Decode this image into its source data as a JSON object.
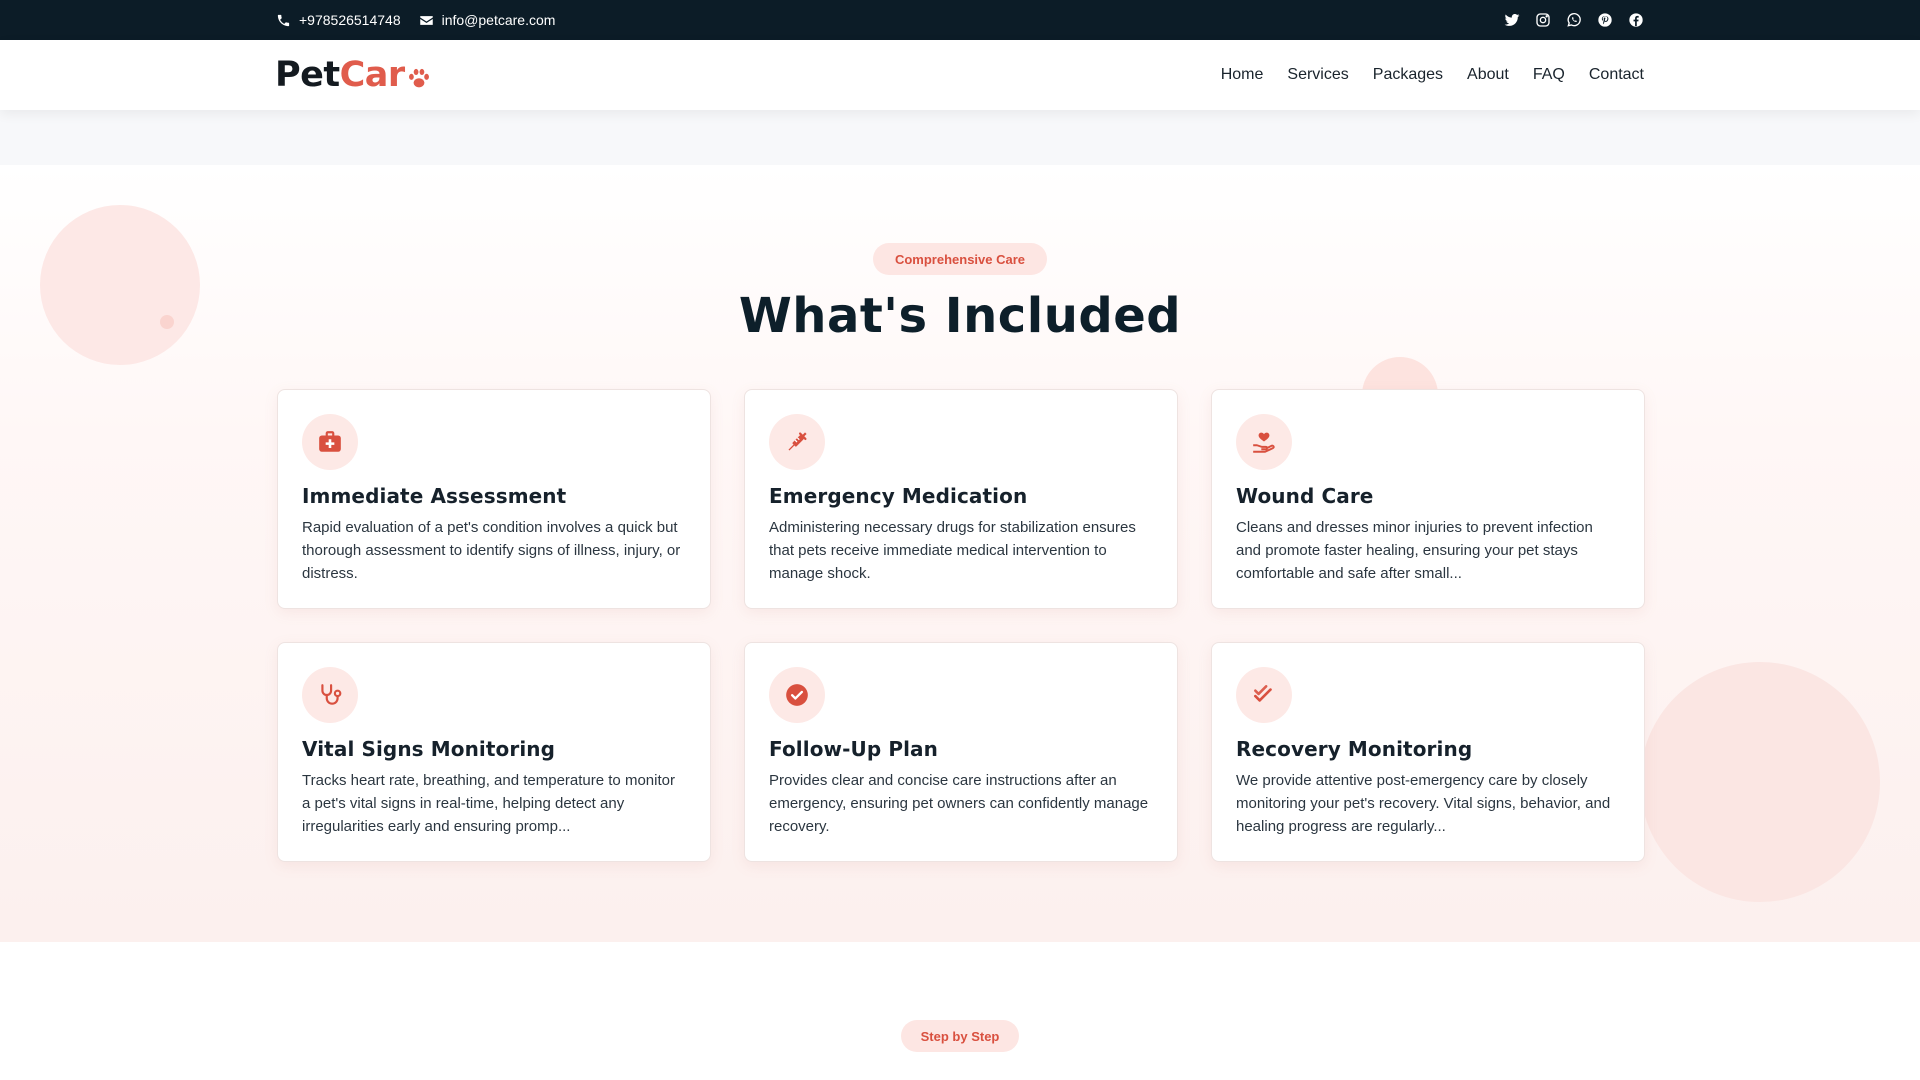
{
  "topbar": {
    "phone": "+978526514748",
    "email": "info@petcare.com",
    "social": [
      "twitter-icon",
      "instagram-icon",
      "whatsapp-icon",
      "pinterest-icon",
      "facebook-icon"
    ]
  },
  "brand": {
    "part1": "Pet",
    "part2": "Car"
  },
  "nav": {
    "items": [
      "Home",
      "Services",
      "Packages",
      "About",
      "FAQ",
      "Contact"
    ]
  },
  "section": {
    "badge": "Comprehensive Care",
    "title": "What's Included"
  },
  "cards": [
    {
      "icon": "medical-kit-icon",
      "title": "Immediate Assessment",
      "text": "Rapid evaluation of a pet's condition involves a quick but thorough assessment to identify signs of illness, injury, or distress."
    },
    {
      "icon": "syringe-icon",
      "title": "Emergency Medication",
      "text": "Administering necessary drugs for stabilization ensures that pets receive immediate medical intervention to manage shock."
    },
    {
      "icon": "hand-holding-heart-icon",
      "title": "Wound Care",
      "text": "Cleans and dresses minor injuries to prevent infection and promote faster healing, ensuring your pet stays comfortable and safe after small..."
    },
    {
      "icon": "stethoscope-icon",
      "title": "Vital Signs Monitoring",
      "text": "Tracks heart rate, breathing, and temperature to monitor a pet's vital signs in real-time, helping detect any irregularities early and ensuring promp..."
    },
    {
      "icon": "check-circle-icon",
      "title": "Follow-Up Plan",
      "text": "Provides clear and concise care instructions after an emergency, ensuring pet owners can confidently manage recovery."
    },
    {
      "icon": "double-check-icon",
      "title": "Recovery Monitoring",
      "text": "We provide attentive post-emergency care by closely monitoring your pet's recovery. Vital signs, behavior, and healing progress are regularly..."
    }
  ],
  "next_section": {
    "badge": "Step by Step"
  },
  "colors": {
    "accent": "#e05c4c",
    "topbar": "#0c1c27",
    "badge_bg": "#fde6e3"
  }
}
